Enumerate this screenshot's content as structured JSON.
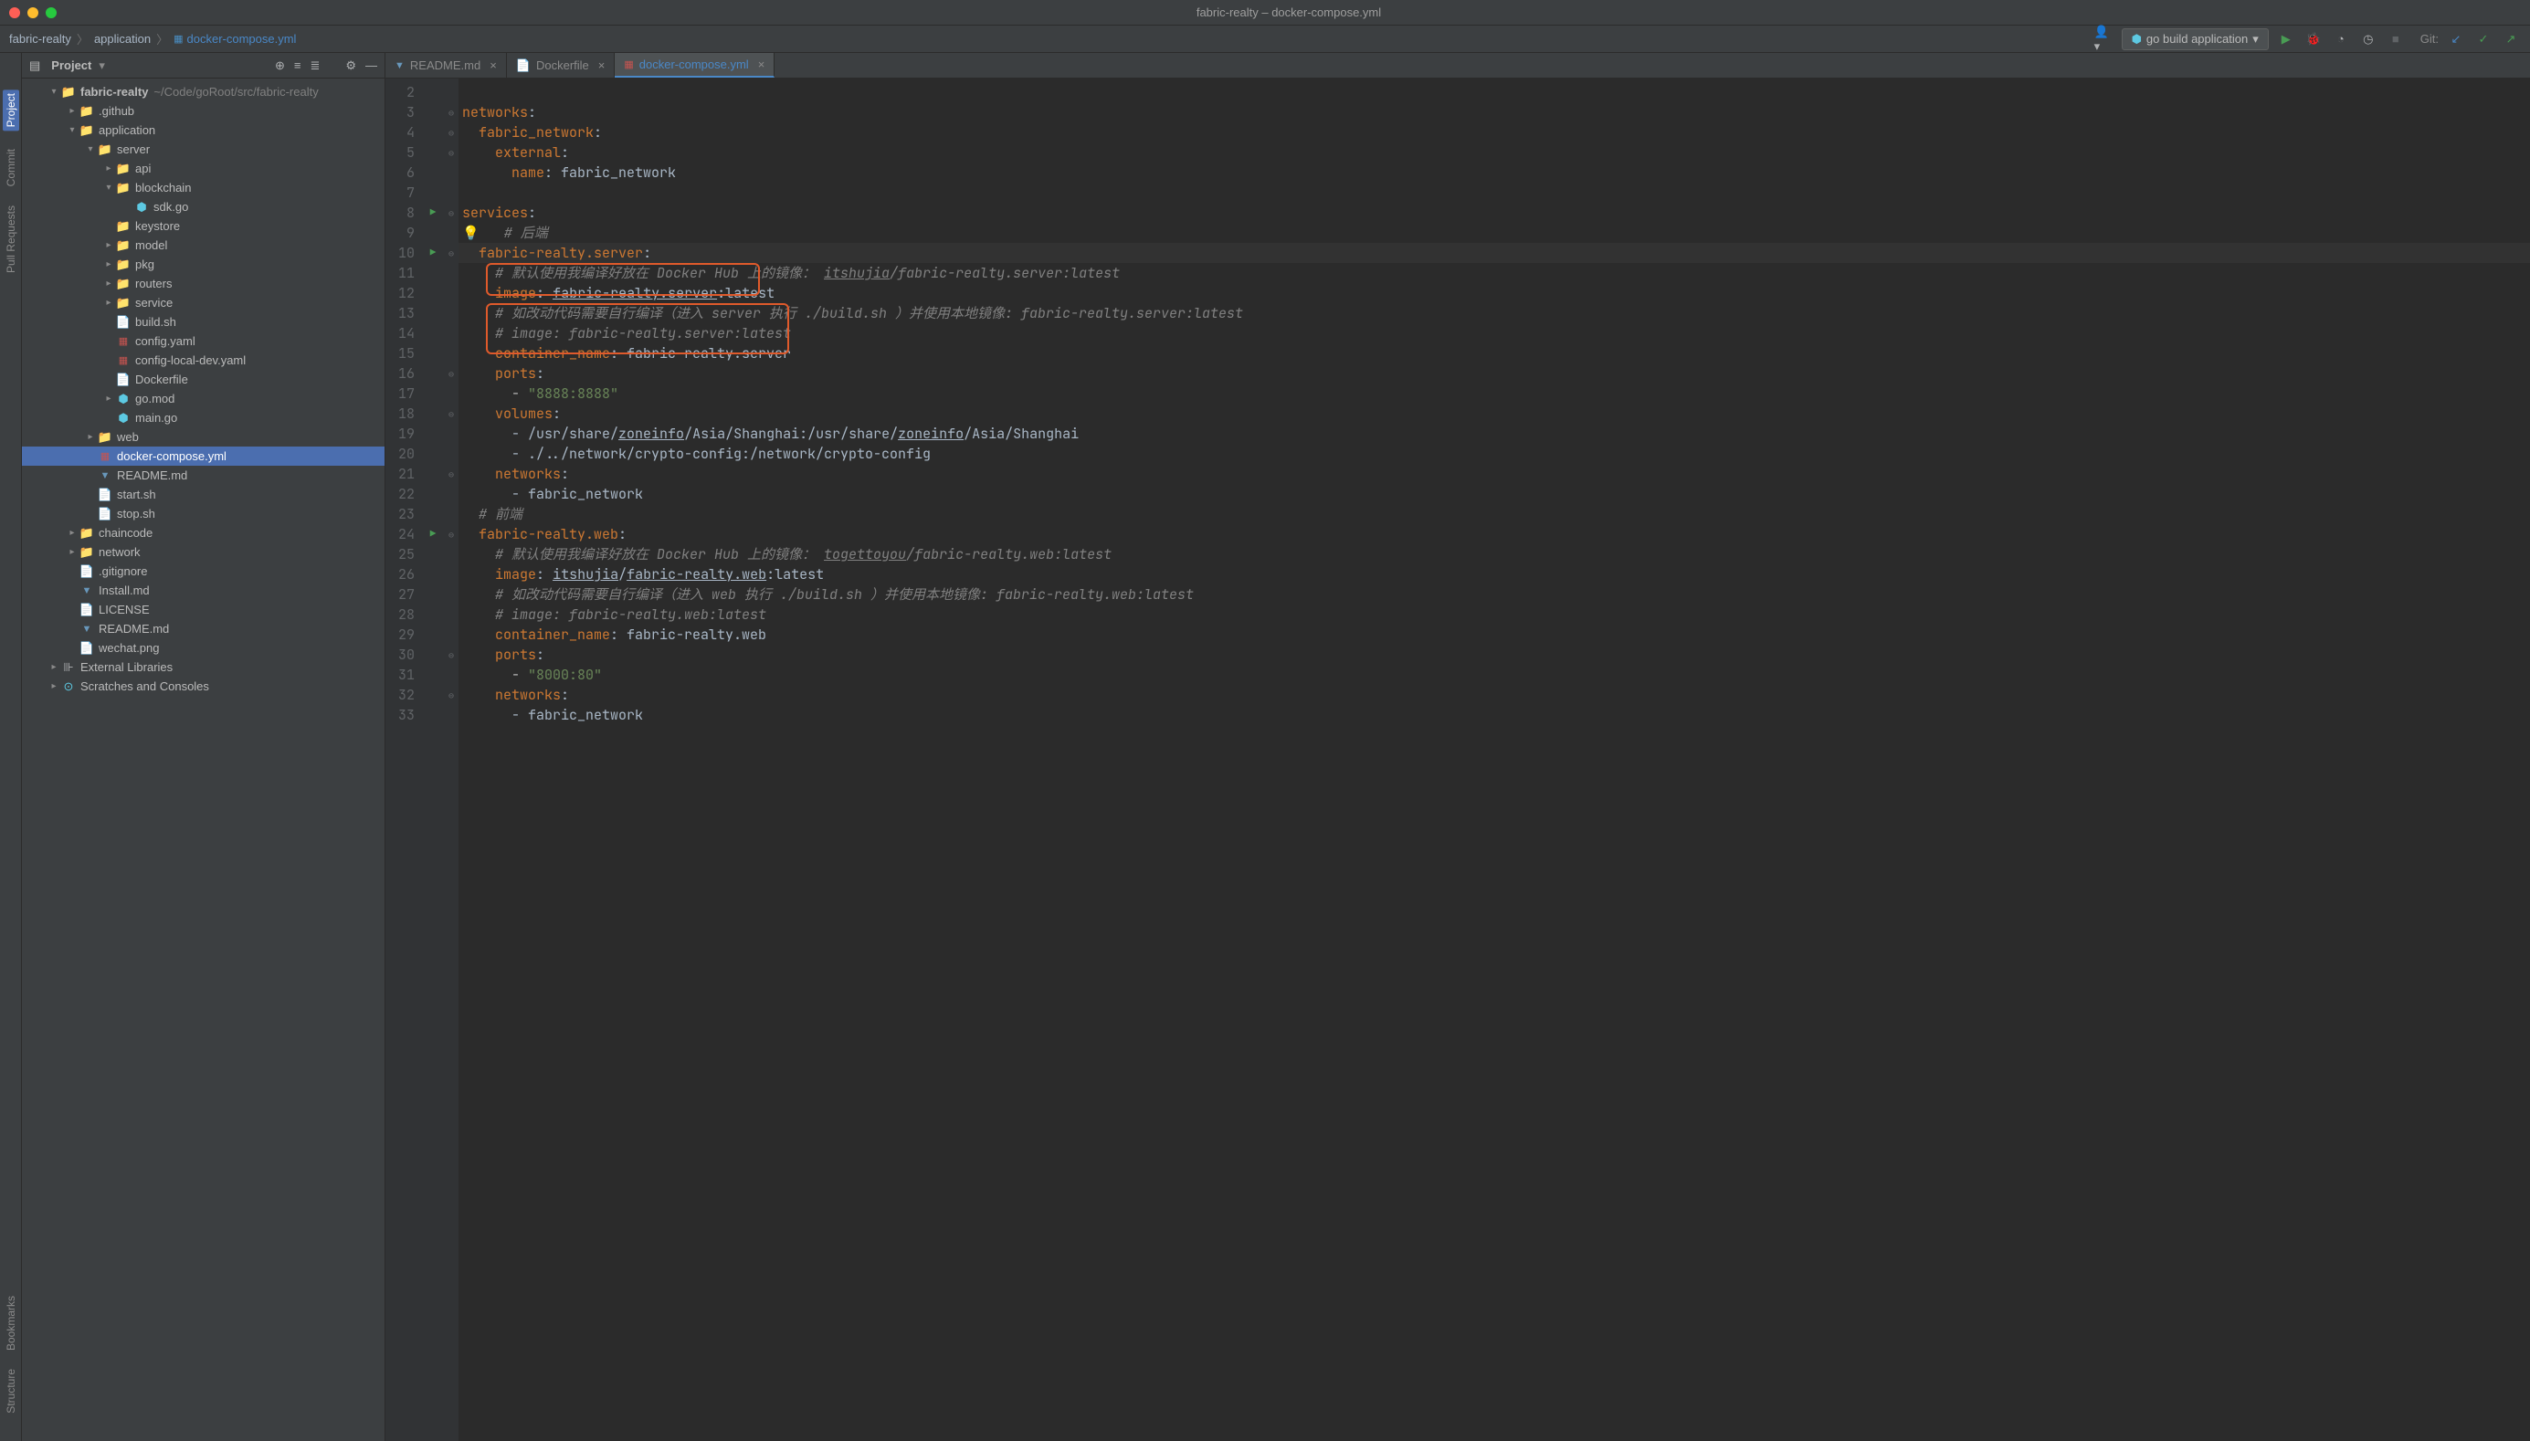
{
  "window": {
    "title": "fabric-realty – docker-compose.yml"
  },
  "breadcrumb": {
    "p1": "fabric-realty",
    "p2": "application",
    "p3": "docker-compose.yml"
  },
  "runConfig": {
    "label": "go build application"
  },
  "git": {
    "label": "Git:"
  },
  "sidebar": {
    "labels": {
      "project": "Project",
      "commit": "Commit",
      "pullRequests": "Pull Requests",
      "structure": "Structure",
      "bookmarks": "Bookmarks"
    }
  },
  "projectPanel": {
    "title": "Project",
    "tree": [
      {
        "indent": 0,
        "arrow": "▾",
        "icon": "folder",
        "label": "fabric-realty",
        "suffix": "~/Code/goRoot/src/fabric-realty",
        "bold": true
      },
      {
        "indent": 1,
        "arrow": "▸",
        "icon": "folder",
        "label": ".github"
      },
      {
        "indent": 1,
        "arrow": "▾",
        "icon": "folder",
        "label": "application"
      },
      {
        "indent": 2,
        "arrow": "▾",
        "icon": "folder",
        "label": "server"
      },
      {
        "indent": 3,
        "arrow": "▸",
        "icon": "folder",
        "label": "api"
      },
      {
        "indent": 3,
        "arrow": "▾",
        "icon": "folder",
        "label": "blockchain"
      },
      {
        "indent": 4,
        "arrow": "",
        "icon": "go",
        "label": "sdk.go"
      },
      {
        "indent": 3,
        "arrow": "",
        "icon": "folder",
        "label": "keystore"
      },
      {
        "indent": 3,
        "arrow": "▸",
        "icon": "folder",
        "label": "model"
      },
      {
        "indent": 3,
        "arrow": "▸",
        "icon": "folder",
        "label": "pkg"
      },
      {
        "indent": 3,
        "arrow": "▸",
        "icon": "folder",
        "label": "routers"
      },
      {
        "indent": 3,
        "arrow": "▸",
        "icon": "folder",
        "label": "service"
      },
      {
        "indent": 3,
        "arrow": "",
        "icon": "file",
        "label": "build.sh"
      },
      {
        "indent": 3,
        "arrow": "",
        "icon": "yml",
        "label": "config.yaml"
      },
      {
        "indent": 3,
        "arrow": "",
        "icon": "yml",
        "label": "config-local-dev.yaml"
      },
      {
        "indent": 3,
        "arrow": "",
        "icon": "file",
        "label": "Dockerfile"
      },
      {
        "indent": 3,
        "arrow": "▸",
        "icon": "go",
        "label": "go.mod"
      },
      {
        "indent": 3,
        "arrow": "",
        "icon": "go",
        "label": "main.go"
      },
      {
        "indent": 2,
        "arrow": "▸",
        "icon": "folder",
        "label": "web"
      },
      {
        "indent": 2,
        "arrow": "",
        "icon": "yml",
        "label": "docker-compose.yml",
        "selected": true
      },
      {
        "indent": 2,
        "arrow": "",
        "icon": "md",
        "label": "README.md"
      },
      {
        "indent": 2,
        "arrow": "",
        "icon": "file",
        "label": "start.sh"
      },
      {
        "indent": 2,
        "arrow": "",
        "icon": "file",
        "label": "stop.sh"
      },
      {
        "indent": 1,
        "arrow": "▸",
        "icon": "folder",
        "label": "chaincode"
      },
      {
        "indent": 1,
        "arrow": "▸",
        "icon": "folder",
        "label": "network"
      },
      {
        "indent": 1,
        "arrow": "",
        "icon": "file",
        "label": ".gitignore"
      },
      {
        "indent": 1,
        "arrow": "",
        "icon": "md",
        "label": "Install.md"
      },
      {
        "indent": 1,
        "arrow": "",
        "icon": "file",
        "label": "LICENSE"
      },
      {
        "indent": 1,
        "arrow": "",
        "icon": "md",
        "label": "README.md"
      },
      {
        "indent": 1,
        "arrow": "",
        "icon": "file",
        "label": "wechat.png"
      },
      {
        "indent": 0,
        "arrow": "▸",
        "icon": "lib",
        "label": "External Libraries"
      },
      {
        "indent": 0,
        "arrow": "▸",
        "icon": "scratch",
        "label": "Scratches and Consoles"
      }
    ]
  },
  "tabs": [
    {
      "icon": "md",
      "label": "README.md"
    },
    {
      "icon": "file",
      "label": "Dockerfile"
    },
    {
      "icon": "yml",
      "label": "docker-compose.yml",
      "active": true
    }
  ],
  "code": {
    "startLine": 2,
    "lines": [
      {
        "n": 2,
        "seg": []
      },
      {
        "n": 3,
        "fold": "⊖",
        "seg": [
          {
            "c": "tok-key",
            "t": "networks"
          },
          {
            "c": "tok-val",
            "t": ":"
          }
        ]
      },
      {
        "n": 4,
        "fold": "⊖",
        "seg": [
          {
            "c": "",
            "t": "  "
          },
          {
            "c": "tok-key",
            "t": "fabric_network"
          },
          {
            "c": "tok-val",
            "t": ":"
          }
        ]
      },
      {
        "n": 5,
        "fold": "⊖",
        "seg": [
          {
            "c": "",
            "t": "    "
          },
          {
            "c": "tok-key",
            "t": "external"
          },
          {
            "c": "tok-val",
            "t": ":"
          }
        ]
      },
      {
        "n": 6,
        "seg": [
          {
            "c": "",
            "t": "      "
          },
          {
            "c": "tok-key",
            "t": "name"
          },
          {
            "c": "tok-val",
            "t": ": fabric_network"
          }
        ]
      },
      {
        "n": 7,
        "seg": []
      },
      {
        "n": 8,
        "run": true,
        "fold": "⊖",
        "seg": [
          {
            "c": "tok-key",
            "t": "services"
          },
          {
            "c": "tok-val",
            "t": ":"
          }
        ]
      },
      {
        "n": 9,
        "bulb": true,
        "seg": [
          {
            "c": "",
            "t": "  "
          },
          {
            "c": "tok-comment",
            "t": "# 后端"
          }
        ]
      },
      {
        "n": 10,
        "run": true,
        "fold": "⊖",
        "current": true,
        "seg": [
          {
            "c": "",
            "t": "  "
          },
          {
            "c": "tok-key",
            "t": "fabric-realty"
          },
          {
            "c": "tok-key",
            "t": ".server"
          },
          {
            "c": "tok-val",
            "t": ":"
          }
        ]
      },
      {
        "n": 11,
        "seg": [
          {
            "c": "",
            "t": "    "
          },
          {
            "c": "tok-comment",
            "t": "# 默认使用我编译好放在 Docker Hub 上的镜像： "
          },
          {
            "c": "tok-link",
            "t": "itshujia"
          },
          {
            "c": "tok-comment",
            "t": "/fabric-realty.server:latest"
          }
        ]
      },
      {
        "n": 12,
        "seg": [
          {
            "c": "",
            "t": "    "
          },
          {
            "c": "tok-key",
            "t": "image"
          },
          {
            "c": "tok-val",
            "t": ": "
          },
          {
            "c": "tok-val tok-under",
            "t": "fabric-realty.server"
          },
          {
            "c": "tok-val",
            "t": ":latest"
          }
        ]
      },
      {
        "n": 13,
        "seg": [
          {
            "c": "",
            "t": "    "
          },
          {
            "c": "tok-comment",
            "t": "# 如改动代码需要自行编译（进入 server 执行 ./build.sh ）并使用本地镜像: fabric-realty.server:latest"
          }
        ]
      },
      {
        "n": 14,
        "seg": [
          {
            "c": "",
            "t": "    "
          },
          {
            "c": "tok-comment",
            "t": "# image: fabric-realty.server:latest"
          }
        ]
      },
      {
        "n": 15,
        "seg": [
          {
            "c": "",
            "t": "    "
          },
          {
            "c": "tok-key",
            "t": "container_name"
          },
          {
            "c": "tok-val",
            "t": ": fabric-realty.server"
          }
        ]
      },
      {
        "n": 16,
        "fold": "⊖",
        "seg": [
          {
            "c": "",
            "t": "    "
          },
          {
            "c": "tok-key",
            "t": "ports"
          },
          {
            "c": "tok-val",
            "t": ":"
          }
        ]
      },
      {
        "n": 17,
        "seg": [
          {
            "c": "",
            "t": "      - "
          },
          {
            "c": "tok-str",
            "t": "\"8888:8888\""
          }
        ]
      },
      {
        "n": 18,
        "fold": "⊖",
        "seg": [
          {
            "c": "",
            "t": "    "
          },
          {
            "c": "tok-key",
            "t": "volumes"
          },
          {
            "c": "tok-val",
            "t": ":"
          }
        ]
      },
      {
        "n": 19,
        "seg": [
          {
            "c": "",
            "t": "      "
          },
          {
            "c": "tok-val",
            "t": "- /usr/share/"
          },
          {
            "c": "tok-val tok-under",
            "t": "zoneinfo"
          },
          {
            "c": "tok-val",
            "t": "/Asia/Shanghai:/usr/share/"
          },
          {
            "c": "tok-val tok-under",
            "t": "zoneinfo"
          },
          {
            "c": "tok-val",
            "t": "/Asia/Shanghai"
          }
        ]
      },
      {
        "n": 20,
        "seg": [
          {
            "c": "",
            "t": "      "
          },
          {
            "c": "tok-val",
            "t": "- ./../network/crypto-config:/network/crypto-config"
          }
        ]
      },
      {
        "n": 21,
        "fold": "⊖",
        "seg": [
          {
            "c": "",
            "t": "    "
          },
          {
            "c": "tok-key",
            "t": "networks"
          },
          {
            "c": "tok-val",
            "t": ":"
          }
        ]
      },
      {
        "n": 22,
        "seg": [
          {
            "c": "",
            "t": "      "
          },
          {
            "c": "tok-val",
            "t": "- fabric_network"
          }
        ]
      },
      {
        "n": 23,
        "seg": [
          {
            "c": "",
            "t": "  "
          },
          {
            "c": "tok-comment",
            "t": "# 前端"
          }
        ]
      },
      {
        "n": 24,
        "run": true,
        "fold": "⊖",
        "seg": [
          {
            "c": "",
            "t": "  "
          },
          {
            "c": "tok-key",
            "t": "fabric-realty.web"
          },
          {
            "c": "tok-val",
            "t": ":"
          }
        ]
      },
      {
        "n": 25,
        "seg": [
          {
            "c": "",
            "t": "    "
          },
          {
            "c": "tok-comment",
            "t": "# 默认使用我编译好放在 Docker Hub 上的镜像： "
          },
          {
            "c": "tok-link",
            "t": "togettoyou"
          },
          {
            "c": "tok-comment",
            "t": "/fabric-realty.web:latest"
          }
        ]
      },
      {
        "n": 26,
        "seg": [
          {
            "c": "",
            "t": "    "
          },
          {
            "c": "tok-key",
            "t": "image"
          },
          {
            "c": "tok-val",
            "t": ": "
          },
          {
            "c": "tok-val tok-under",
            "t": "itshujia"
          },
          {
            "c": "tok-val",
            "t": "/"
          },
          {
            "c": "tok-val tok-under",
            "t": "fabric-realty.web"
          },
          {
            "c": "tok-val",
            "t": ":latest"
          }
        ]
      },
      {
        "n": 27,
        "seg": [
          {
            "c": "",
            "t": "    "
          },
          {
            "c": "tok-comment",
            "t": "# 如改动代码需要自行编译（进入 web 执行 ./build.sh ）并使用本地镜像: fabric-realty.web:latest"
          }
        ]
      },
      {
        "n": 28,
        "seg": [
          {
            "c": "",
            "t": "    "
          },
          {
            "c": "tok-comment",
            "t": "# image: fabric-realty.web:latest"
          }
        ]
      },
      {
        "n": 29,
        "seg": [
          {
            "c": "",
            "t": "    "
          },
          {
            "c": "tok-key",
            "t": "container_name"
          },
          {
            "c": "tok-val",
            "t": ": fabric-realty.web"
          }
        ]
      },
      {
        "n": 30,
        "fold": "⊖",
        "seg": [
          {
            "c": "",
            "t": "    "
          },
          {
            "c": "tok-key",
            "t": "ports"
          },
          {
            "c": "tok-val",
            "t": ":"
          }
        ]
      },
      {
        "n": 31,
        "seg": [
          {
            "c": "",
            "t": "      - "
          },
          {
            "c": "tok-str",
            "t": "\"8000:80\""
          }
        ]
      },
      {
        "n": 32,
        "fold": "⊖",
        "seg": [
          {
            "c": "",
            "t": "    "
          },
          {
            "c": "tok-key",
            "t": "networks"
          },
          {
            "c": "tok-val",
            "t": ":"
          }
        ]
      },
      {
        "n": 33,
        "seg": [
          {
            "c": "",
            "t": "      "
          },
          {
            "c": "tok-val",
            "t": "- fabric_network"
          }
        ]
      }
    ]
  }
}
